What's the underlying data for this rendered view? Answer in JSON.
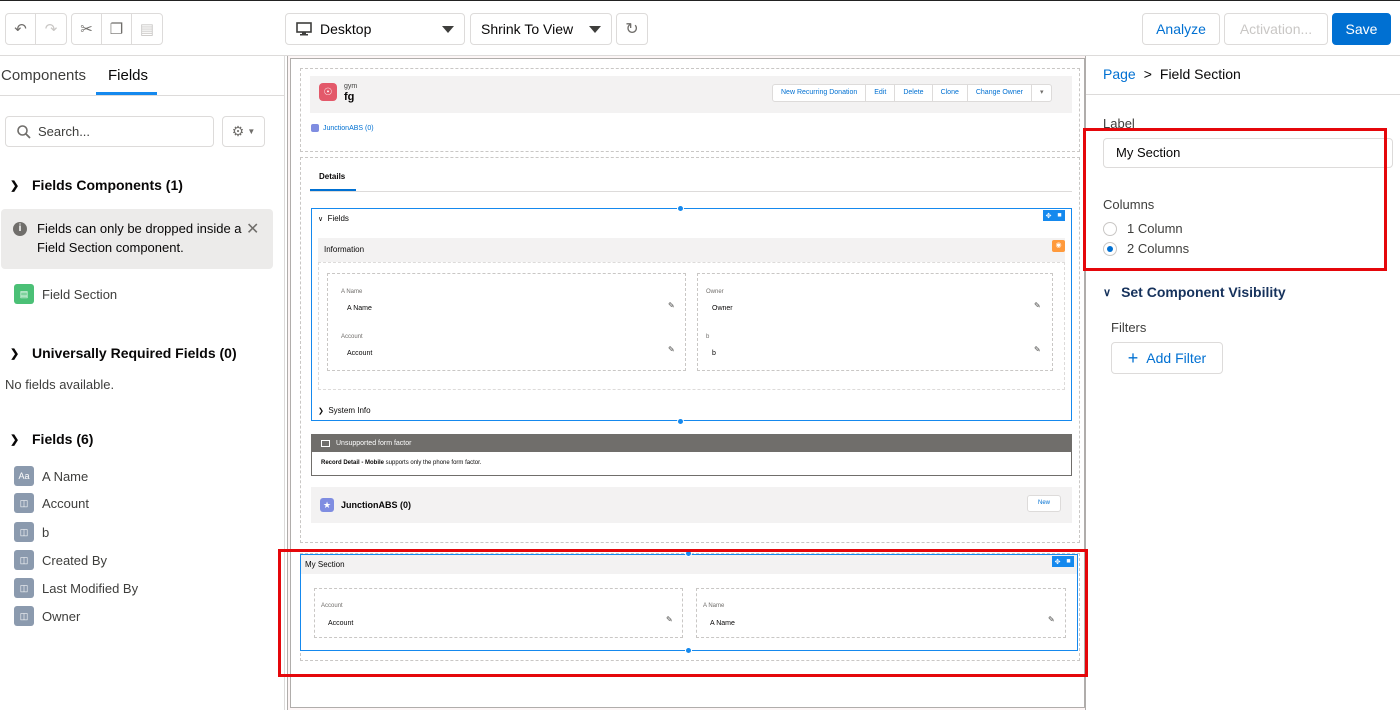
{
  "toolbar": {
    "undo_icon": "undo-icon",
    "redo_icon": "redo-icon",
    "cut_icon": "cut-icon",
    "copy_icon": "copy-icon",
    "paste_icon": "paste-icon",
    "device_select": "Desktop",
    "view_select": "Shrink To View",
    "refresh_icon": "refresh-icon",
    "analyze": "Analyze",
    "activation": "Activation...",
    "save": "Save"
  },
  "left": {
    "tabs": [
      "Components",
      "Fields"
    ],
    "active_tab": "Fields",
    "search_placeholder": "Search...",
    "fields_components_header": "Fields Components (1)",
    "info_message": "Fields can only be dropped inside a Field Section component.",
    "field_section_item": "Field Section",
    "universally_required_header": "Universally Required Fields (0)",
    "no_fields_text": "No fields available.",
    "fields_header": "Fields (6)",
    "fields": [
      "A Name",
      "Account",
      "b",
      "Created By",
      "Last Modified By",
      "Owner"
    ]
  },
  "canvas": {
    "record_type": "gym",
    "record_name": "fg",
    "actions": [
      "New Recurring Donation",
      "Edit",
      "Delete",
      "Clone",
      "Change Owner"
    ],
    "highlight_link": "JunctionABS (0)",
    "details_tab": "Details",
    "fields_section": "Fields",
    "information_header": "Information",
    "info_fields": [
      {
        "label": "A Name",
        "value": "A Name"
      },
      {
        "label": "Owner",
        "value": "Owner"
      },
      {
        "label": "Account",
        "value": "Account"
      },
      {
        "label": "b",
        "value": "b"
      }
    ],
    "system_info": "System Info",
    "unsupported_header": "Unsupported form factor",
    "unsupported_bold": "Record Detail - Mobile",
    "unsupported_text": " supports only the phone form factor.",
    "related_title": "JunctionABS (0)",
    "related_new": "New",
    "my_section": {
      "title": "My Section",
      "fields": [
        {
          "label": "Account",
          "value": "Account"
        },
        {
          "label": "A Name",
          "value": "A Name"
        }
      ]
    }
  },
  "right": {
    "breadcrumb_page": "Page",
    "breadcrumb_sep": ">",
    "breadcrumb_current": "Field Section",
    "label_title": "Label",
    "label_value": "My Section",
    "columns_title": "Columns",
    "column_options": [
      "1 Column",
      "2 Columns"
    ],
    "selected_columns": "2 Columns",
    "visibility_header": "Set Component Visibility",
    "filters_label": "Filters",
    "add_filter": "Add Filter"
  },
  "colors": {
    "accent": "#0070d2",
    "highlight_red": "#e5070b",
    "selection_blue": "#1589ee"
  }
}
